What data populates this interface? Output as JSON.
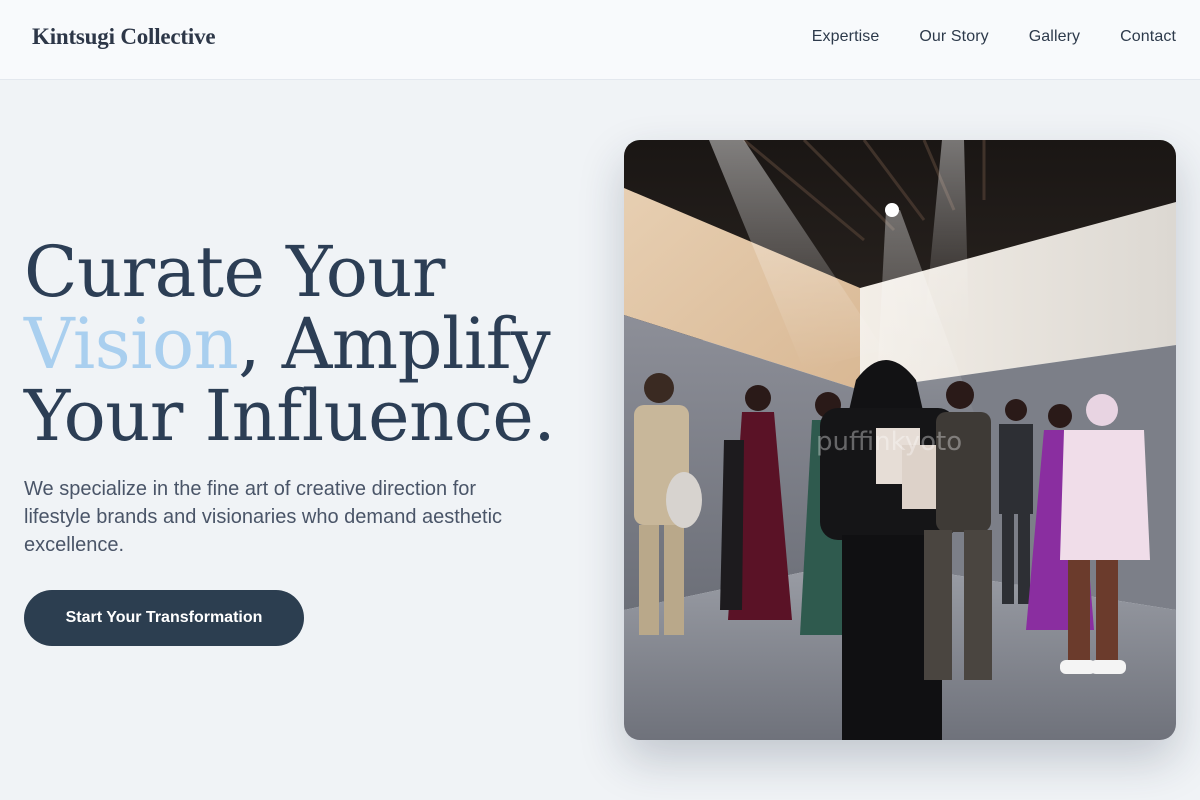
{
  "header": {
    "brand": "Kintsugi Collective",
    "nav": [
      "Expertise",
      "Our Story",
      "Gallery",
      "Contact"
    ]
  },
  "hero": {
    "headline_part1": "Curate Your ",
    "headline_accent": "Vision",
    "headline_part2": ", Amplify Your Influence.",
    "subtext": "We specialize in the fine art of creative direction for lifestyle brands and visionaries who demand aesthetic excellence.",
    "cta_label": "Start Your Transformation",
    "image": {
      "watermark": "puffinkyoto"
    }
  },
  "colors": {
    "background": "#f0f3f6",
    "accent": "#a9cfef",
    "primary": "#2c3e50"
  }
}
